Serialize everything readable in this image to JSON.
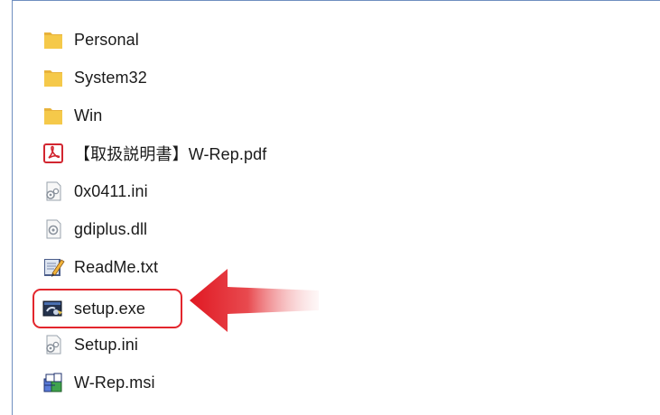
{
  "file_list": {
    "items": [
      {
        "name": "Personal",
        "icon": "folder-icon"
      },
      {
        "name": "System32",
        "icon": "folder-icon"
      },
      {
        "name": "Win",
        "icon": "folder-icon"
      },
      {
        "name": "【取扱説明書】W-Rep.pdf",
        "icon": "pdf-file-icon"
      },
      {
        "name": "0x0411.ini",
        "icon": "settings-file-icon"
      },
      {
        "name": "gdiplus.dll",
        "icon": "dll-file-icon"
      },
      {
        "name": "ReadMe.txt",
        "icon": "text-file-icon"
      },
      {
        "name": "setup.exe",
        "icon": "exe-app-icon"
      },
      {
        "name": "Setup.ini",
        "icon": "settings-file-icon"
      },
      {
        "name": "W-Rep.msi",
        "icon": "msi-installer-icon"
      }
    ]
  },
  "annotation": {
    "highlighted_item": "setup.exe",
    "highlight_color": "#e3262d",
    "arrow_icon": "red-arrow-left-icon"
  },
  "colors": {
    "folder": "#f5c94a",
    "frame_border": "#6f8fc0",
    "text": "#1a1a1a"
  }
}
